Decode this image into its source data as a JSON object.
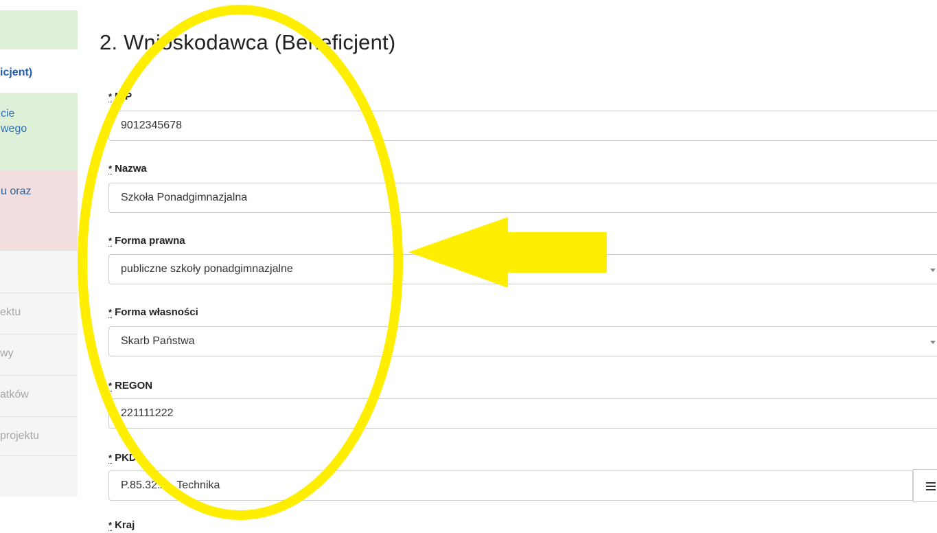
{
  "sidebar": {
    "items": [
      {
        "label": "icjent)"
      },
      {
        "label": "cie"
      },
      {
        "label": "wego"
      },
      {
        "label": "u oraz"
      },
      {
        "label": "ektu"
      },
      {
        "label": "wy"
      },
      {
        "label": "atków"
      },
      {
        "label": "projektu"
      }
    ]
  },
  "page": {
    "title": "2. Wnioskodawca (Beneficjent)"
  },
  "form": {
    "required_mark": "*",
    "fields": [
      {
        "label": "NIP",
        "value": "9012345678"
      },
      {
        "label": "Nazwa",
        "value": "Szkoła Ponadgimnazjalna"
      },
      {
        "label": "Forma prawna",
        "value": "publiczne szkoły ponadgimnazjalne"
      },
      {
        "label": "Forma własności",
        "value": "Skarb Państwa"
      },
      {
        "label": "REGON",
        "value": "221111222"
      },
      {
        "label": "PKD",
        "value": "P.85.32.A - Technika"
      },
      {
        "label": "Kraj",
        "value": ""
      }
    ]
  },
  "colors": {
    "annotation": "#ffee00",
    "sidebar_success": "#dff0d8",
    "sidebar_danger": "#f2dede"
  },
  "icons": {
    "pkd_addon": "menu-icon",
    "select_caret": "chevron-down-icon"
  }
}
